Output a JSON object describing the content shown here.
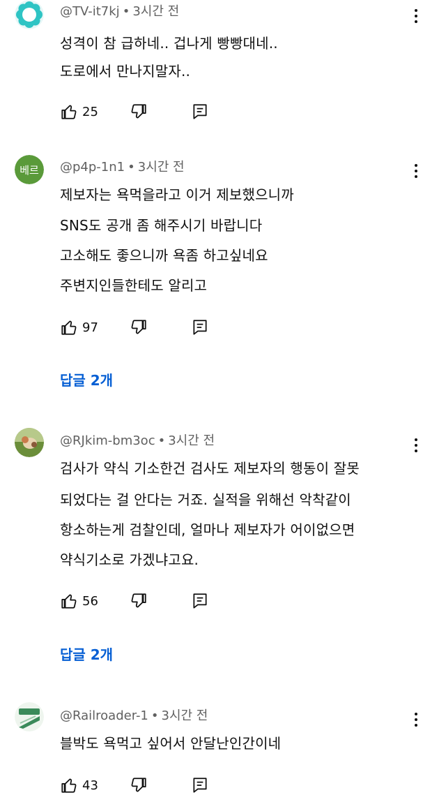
{
  "comments": [
    {
      "author": "@TV-it7kj",
      "time": "3시간 전",
      "lines": [
        "성격이 참 급하네.. 겁나게 빵빵대네..",
        "도로에서 만나지말자.."
      ],
      "likes": "25",
      "avatar": {
        "type": "flower",
        "color": "#2ec4c4"
      }
    },
    {
      "author": "@p4p-1n1",
      "time": "3시간 전",
      "lines": [
        "제보자는 욕먹을라고 이거 제보했으니까",
        "SNS도 공개 좀 해주시기 바랍니다",
        "고소해도 좋으니까 욕좀 하고싶네요",
        "주변지인들한테도 알리고"
      ],
      "likes": "97",
      "reply_label": "답글 2개",
      "avatar": {
        "type": "text",
        "text": "베르",
        "color": "#5a9a3a"
      }
    },
    {
      "author": "@RJkim-bm3oc",
      "time": "3시간 전",
      "lines": [
        "검사가 약식 기소한건 검사도 제보자의 행동이 잘못",
        "되었다는 걸 안다는 거죠. 실적을 위해선 악착같이",
        "항소하는게 검찰인데, 얼마나 제보자가 어이없으면",
        "약식기소로 가겠냐고요."
      ],
      "likes": "56",
      "reply_label": "답글 2개",
      "avatar": {
        "type": "image",
        "color": "#6b8e3a"
      }
    },
    {
      "author": "@Railroader-1",
      "time": "3시간 전",
      "lines": [
        "블박도 욕먹고 싶어서 안달난인간이네"
      ],
      "likes": "43",
      "avatar": {
        "type": "logo",
        "color": "#3a8a5a"
      }
    }
  ],
  "icons": {
    "like": "thumbs-up-icon",
    "dislike": "thumbs-down-icon",
    "reply": "reply-icon",
    "more": "more-vert-icon"
  }
}
